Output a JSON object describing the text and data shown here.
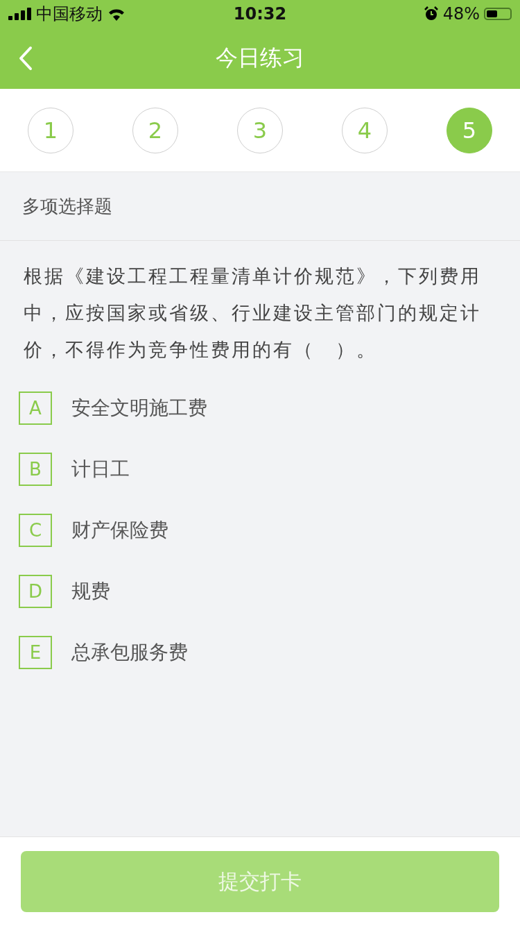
{
  "status_bar": {
    "carrier": "中国移动",
    "time": "10:32",
    "battery": "48%"
  },
  "nav": {
    "title": "今日练习"
  },
  "steps": [
    {
      "label": "1",
      "selected": false
    },
    {
      "label": "2",
      "selected": false
    },
    {
      "label": "3",
      "selected": false
    },
    {
      "label": "4",
      "selected": false
    },
    {
      "label": "5",
      "selected": true
    }
  ],
  "question_type": "多项选择题",
  "question": "根据《建设工程工程量清单计价规范》，下列费用中，应按国家或省级、行业建设主管部门的规定计价，不得作为竞争性费用的有（　）。",
  "options": [
    {
      "letter": "A",
      "text": "安全文明施工费",
      "checked": false
    },
    {
      "letter": "B",
      "text": "计日工",
      "checked": false
    },
    {
      "letter": "C",
      "text": "财产保险费",
      "checked": false
    },
    {
      "letter": "D",
      "text": "规费",
      "checked": false
    },
    {
      "letter": "E",
      "text": "总承包服务费",
      "checked": false
    }
  ],
  "submit": {
    "label": "提交打卡",
    "disabled": true
  }
}
